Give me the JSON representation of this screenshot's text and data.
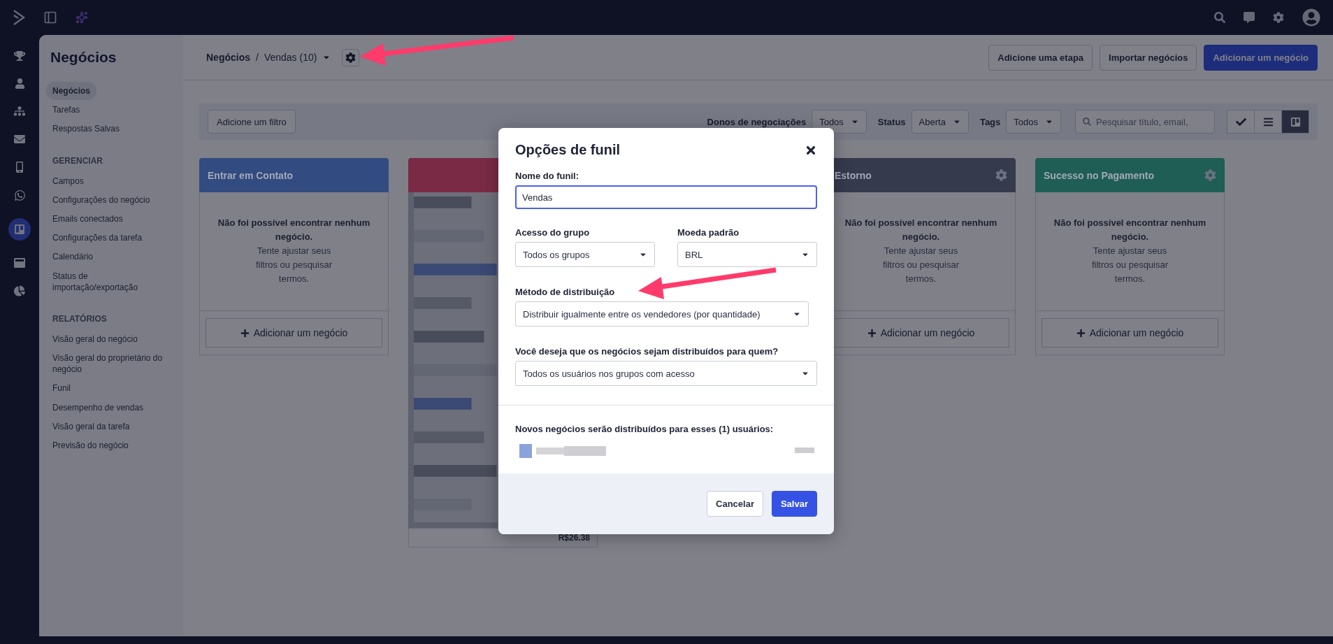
{
  "sidebar": {
    "title": "Negócios",
    "sections": [
      {
        "items": [
          {
            "label": "Negócios",
            "selected": true
          },
          {
            "label": "Tarefas",
            "selected": false
          },
          {
            "label": "Respostas Salvas",
            "selected": false
          }
        ]
      },
      {
        "heading": "GERENCIAR",
        "items": [
          {
            "label": "Campos",
            "selected": false
          },
          {
            "label": "Configurações do negócio",
            "selected": false
          },
          {
            "label": "Emails conectados",
            "selected": false
          },
          {
            "label": "Configurações da tarefa",
            "selected": false
          },
          {
            "label": "Calendário",
            "selected": false
          },
          {
            "label": "Status de importação/exportação",
            "selected": false
          }
        ]
      },
      {
        "heading": "RELATÓRIOS",
        "items": [
          {
            "label": "Visão geral do negócio",
            "selected": false
          },
          {
            "label": "Visão geral do proprietário do negócio",
            "selected": false
          },
          {
            "label": "Funil",
            "selected": false
          },
          {
            "label": "Desempenho de vendas",
            "selected": false
          },
          {
            "label": "Visão geral da tarefa",
            "selected": false
          },
          {
            "label": "Previsão do negócio",
            "selected": false
          }
        ]
      }
    ]
  },
  "header": {
    "breadcrumb_root": "Negócios",
    "breadcrumb_separator": "/",
    "breadcrumb_current": "Vendas (10)",
    "buttons": [
      {
        "label": "Adicione uma etapa",
        "kind": "secondary"
      },
      {
        "label": "Importar negócios",
        "kind": "secondary"
      },
      {
        "label": "Adicionar um negócio",
        "kind": "primary"
      }
    ]
  },
  "filters": {
    "add_filter": "Adicione um filtro",
    "selects": [
      {
        "label": "Donos de negociações",
        "value": "Todos"
      },
      {
        "label": "Status",
        "value": "Aberta"
      },
      {
        "label": "Tags",
        "value": "Todos"
      }
    ],
    "search": {
      "placeholder": "Pesquisar título, email,"
    },
    "views": [
      {
        "kind": "check",
        "selected": false
      },
      {
        "kind": "list",
        "selected": false
      },
      {
        "kind": "board",
        "selected": true
      }
    ]
  },
  "columns": [
    {
      "kind": "empty",
      "title": "Entrar em Contato",
      "color": "#324b80",
      "empty_title": "Não foi possível encontrar nenhum negócio.",
      "empty_hint": "Tente ajustar seus filtros ou pesquisar termos.",
      "add": "Adicionar um negócio"
    },
    {
      "kind": "redacted",
      "color": "#7a2a45",
      "card_value": "R$26.38"
    },
    {
      "kind": "hidden"
    },
    {
      "kind": "empty",
      "title": "Estorno",
      "color": "#363a4d",
      "empty_title": "Não foi possível encontrar nenhum negócio.",
      "empty_hint": "Tente ajustar seus filtros ou pesquisar termos.",
      "add": "Adicionar um negócio"
    },
    {
      "kind": "empty",
      "title": "Sucesso no Pagamento",
      "color": "#1f5e54",
      "empty_title": "Não foi possível encontrar nenhum negócio.",
      "empty_hint": "Tente ajustar seus filtros ou pesquisar termos.",
      "add": "Adicionar um negócio"
    }
  ],
  "modal": {
    "title": "Opções de funil",
    "name": {
      "label": "Nome do funil:",
      "value": "Vendas"
    },
    "group_access": {
      "label": "Acesso do grupo",
      "value": "Todos os grupos"
    },
    "currency": {
      "label": "Moeda padrão",
      "value": "BRL"
    },
    "distribution": {
      "label": "Método de distribuição",
      "value": "Distribuir igualmente entre os vendedores (por quantidade)"
    },
    "recipients": {
      "label": "Você deseja que os negócios sejam distribuídos para quem?",
      "value": "Todos os usuários nos grupos com acesso"
    },
    "users_note": "Novos negócios serão distribuídos para esses (1) usuários:",
    "buttons": [
      {
        "label": "Cancelar",
        "kind": "secondary"
      },
      {
        "label": "Salvar",
        "kind": "primary"
      }
    ]
  }
}
